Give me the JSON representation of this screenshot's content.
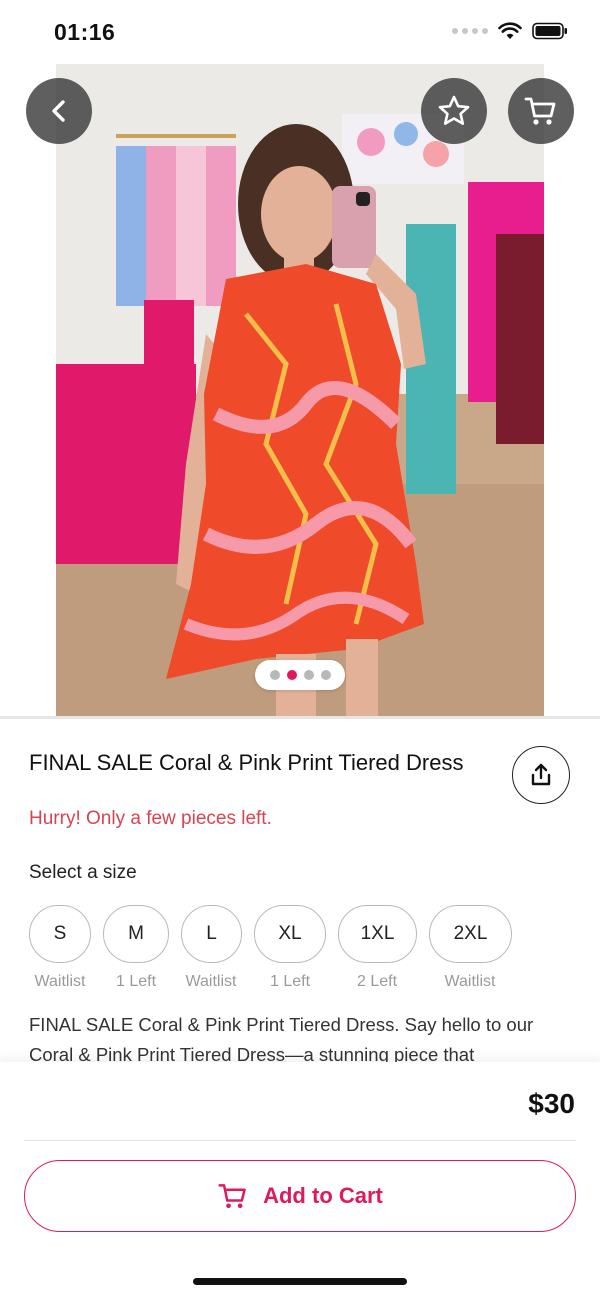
{
  "status_bar": {
    "time": "01:16"
  },
  "hero": {
    "page_count": 4,
    "active_page": 1
  },
  "product": {
    "title": "FINAL SALE Coral & Pink Print Tiered Dress",
    "stock_note": "Hurry! Only a few pieces left.",
    "size_label": "Select a size",
    "sizes": [
      {
        "size": "S",
        "status": "Waitlist"
      },
      {
        "size": "M",
        "status": "1 Left"
      },
      {
        "size": "L",
        "status": "Waitlist"
      },
      {
        "size": "XL",
        "status": "1 Left"
      },
      {
        "size": "1XL",
        "status": "2 Left"
      },
      {
        "size": "2XL",
        "status": "Waitlist"
      }
    ],
    "description": "FINAL SALE Coral & Pink Print Tiered Dress. Say hello to our Coral & Pink Print Tiered Dress—a stunning piece that"
  },
  "purchase": {
    "price": "$30",
    "add_to_cart_label": "Add to Cart"
  },
  "icons": {
    "back": "chevron-left-icon",
    "favorite": "star-icon",
    "cart": "cart-icon",
    "share": "share-icon"
  },
  "colors": {
    "accent": "#e0195b",
    "stock_warning": "#d9434f",
    "overlay_button": "#3c3c3c"
  }
}
